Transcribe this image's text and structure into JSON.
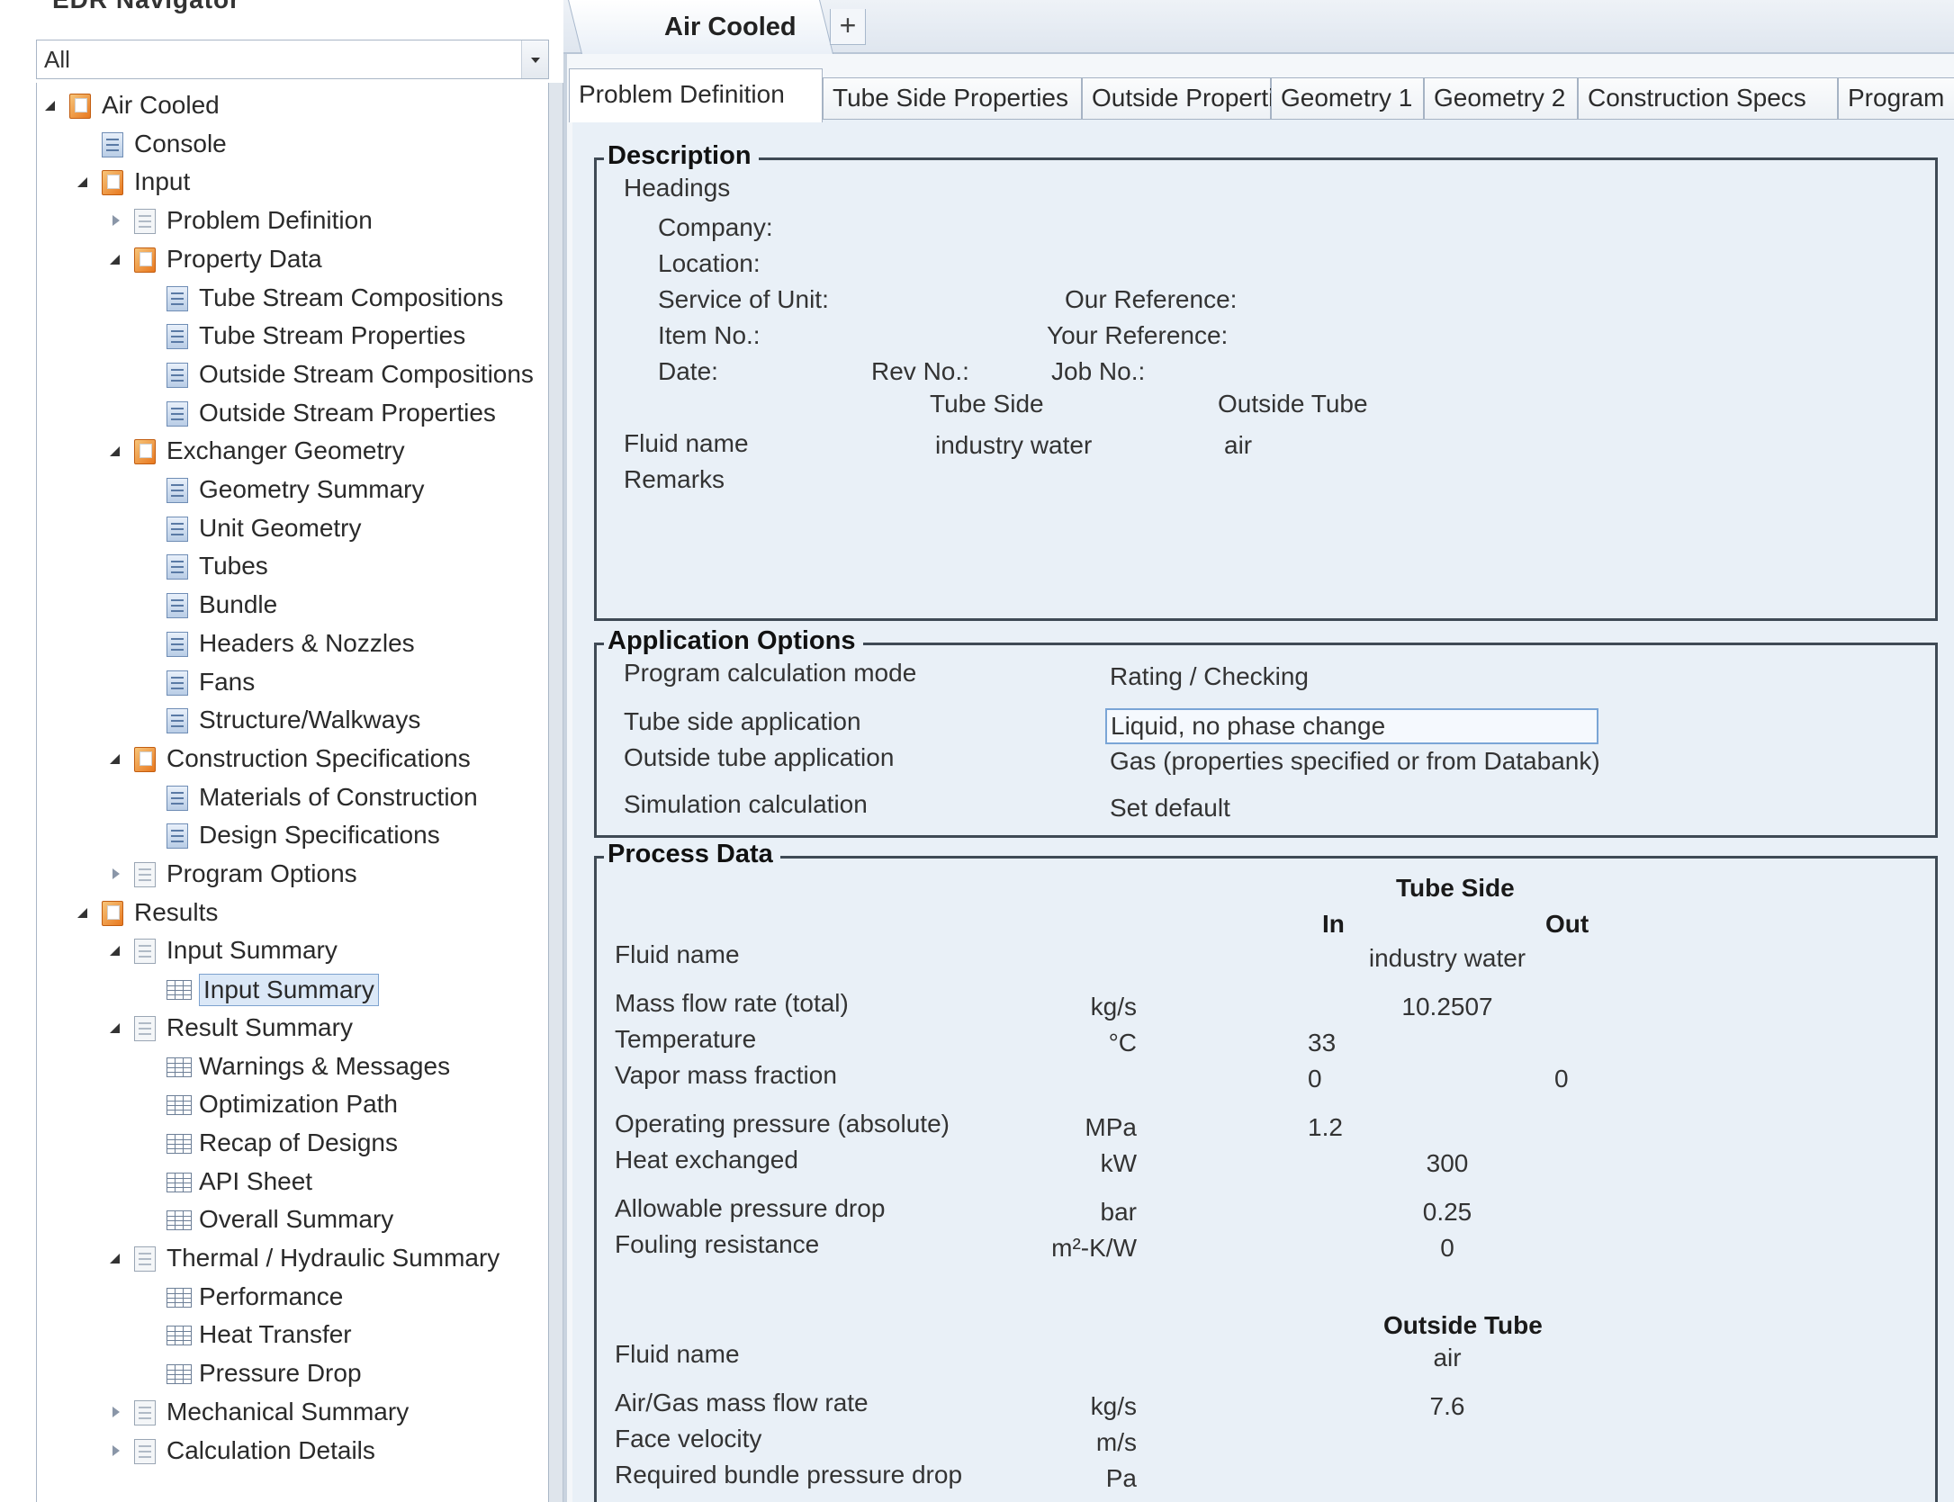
{
  "navigator": {
    "title": "EDR Navigator",
    "filter_value": "All",
    "tree": [
      {
        "label": "Air Cooled",
        "level": 0,
        "toggle": "expanded",
        "icon": "folder-icon"
      },
      {
        "label": "Console",
        "level": 1,
        "toggle": "none",
        "icon": "form-icon"
      },
      {
        "label": "Input",
        "level": 1,
        "toggle": "expanded",
        "icon": "folder-icon"
      },
      {
        "label": "Problem Definition",
        "level": 2,
        "toggle": "collapsed",
        "icon": "doc-icon"
      },
      {
        "label": "Property Data",
        "level": 2,
        "toggle": "expanded",
        "icon": "folder-icon"
      },
      {
        "label": "Tube Stream Compositions",
        "level": 3,
        "toggle": "none",
        "icon": "form-icon"
      },
      {
        "label": "Tube Stream Properties",
        "level": 3,
        "toggle": "none",
        "icon": "form-icon"
      },
      {
        "label": "Outside Stream Compositions",
        "level": 3,
        "toggle": "none",
        "icon": "form-icon"
      },
      {
        "label": "Outside Stream Properties",
        "level": 3,
        "toggle": "none",
        "icon": "form-icon"
      },
      {
        "label": "Exchanger Geometry",
        "level": 2,
        "toggle": "expanded",
        "icon": "folder-icon"
      },
      {
        "label": "Geometry Summary",
        "level": 3,
        "toggle": "none",
        "icon": "form-icon"
      },
      {
        "label": "Unit Geometry",
        "level": 3,
        "toggle": "none",
        "icon": "form-icon"
      },
      {
        "label": "Tubes",
        "level": 3,
        "toggle": "none",
        "icon": "form-icon"
      },
      {
        "label": "Bundle",
        "level": 3,
        "toggle": "none",
        "icon": "form-icon"
      },
      {
        "label": "Headers & Nozzles",
        "level": 3,
        "toggle": "none",
        "icon": "form-icon"
      },
      {
        "label": "Fans",
        "level": 3,
        "toggle": "none",
        "icon": "form-icon"
      },
      {
        "label": "Structure/Walkways",
        "level": 3,
        "toggle": "none",
        "icon": "form-icon"
      },
      {
        "label": "Construction Specifications",
        "level": 2,
        "toggle": "expanded",
        "icon": "folder-icon"
      },
      {
        "label": "Materials of Construction",
        "level": 3,
        "toggle": "none",
        "icon": "form-icon"
      },
      {
        "label": "Design Specifications",
        "level": 3,
        "toggle": "none",
        "icon": "form-icon"
      },
      {
        "label": "Program Options",
        "level": 2,
        "toggle": "collapsed",
        "icon": "doc-icon"
      },
      {
        "label": "Results",
        "level": 1,
        "toggle": "expanded",
        "icon": "folder-icon"
      },
      {
        "label": "Input Summary",
        "level": 2,
        "toggle": "expanded",
        "icon": "doc-icon"
      },
      {
        "label": "Input Summary",
        "level": 3,
        "toggle": "none",
        "icon": "table-icon",
        "selected": true
      },
      {
        "label": "Result Summary",
        "level": 2,
        "toggle": "expanded",
        "icon": "doc-icon"
      },
      {
        "label": "Warnings & Messages",
        "level": 3,
        "toggle": "none",
        "icon": "table-icon"
      },
      {
        "label": "Optimization Path",
        "level": 3,
        "toggle": "none",
        "icon": "table-icon"
      },
      {
        "label": "Recap of Designs",
        "level": 3,
        "toggle": "none",
        "icon": "table-icon"
      },
      {
        "label": "API Sheet",
        "level": 3,
        "toggle": "none",
        "icon": "table-icon"
      },
      {
        "label": "Overall Summary",
        "level": 3,
        "toggle": "none",
        "icon": "table-icon"
      },
      {
        "label": "Thermal / Hydraulic Summary",
        "level": 2,
        "toggle": "expanded",
        "icon": "doc-icon"
      },
      {
        "label": "Performance",
        "level": 3,
        "toggle": "none",
        "icon": "table-icon"
      },
      {
        "label": "Heat Transfer",
        "level": 3,
        "toggle": "none",
        "icon": "table-icon"
      },
      {
        "label": "Pressure Drop",
        "level": 3,
        "toggle": "none",
        "icon": "table-icon"
      },
      {
        "label": "Mechanical Summary",
        "level": 2,
        "toggle": "collapsed",
        "icon": "doc-icon"
      },
      {
        "label": "Calculation Details",
        "level": 2,
        "toggle": "collapsed",
        "icon": "doc-icon"
      }
    ]
  },
  "doc_tabs": {
    "active_label": "Air Cooled",
    "add_label": "+"
  },
  "subtabs": [
    {
      "label": "Problem Definition",
      "active": true
    },
    {
      "label": "Tube Side Properties"
    },
    {
      "label": "Outside Properties"
    },
    {
      "label": "Geometry 1"
    },
    {
      "label": "Geometry 2"
    },
    {
      "label": "Construction Specs"
    },
    {
      "label": "Program"
    }
  ],
  "description": {
    "legend": "Description",
    "headings_label": "Headings",
    "company_label": "Company:",
    "location_label": "Location:",
    "service_label": "Service of Unit:",
    "our_ref_label": "Our Reference:",
    "item_label": "Item No.:",
    "your_ref_label": "Your Reference:",
    "date_label": "Date:",
    "rev_label": "Rev No.:",
    "job_label": "Job No.:",
    "tube_side_header": "Tube Side",
    "outside_tube_header": "Outside Tube",
    "fluid_name_label": "Fluid name",
    "fluid_tube_value": "industry water",
    "fluid_outside_value": "air",
    "remarks_label": "Remarks"
  },
  "application": {
    "legend": "Application Options",
    "rows": [
      {
        "label": "Program calculation mode",
        "value": "Rating / Checking"
      },
      {
        "label": "Tube side application",
        "value": "Liquid, no phase change"
      },
      {
        "label": "Outside tube application",
        "value": "Gas (properties specified or from Databank)"
      },
      {
        "label": "Simulation calculation",
        "value": "Set default"
      }
    ]
  },
  "process": {
    "legend": "Process Data",
    "tube_side_header": "Tube Side",
    "in_header": "In",
    "out_header": "Out",
    "outside_tube_header": "Outside Tube",
    "tube_rows": [
      {
        "label": "Fluid name",
        "unit": "",
        "in": "",
        "span": "industry water",
        "out": ""
      },
      {
        "label": "Mass flow rate (total)",
        "unit": "kg/s",
        "in": "",
        "span": "10.2507",
        "out": ""
      },
      {
        "label": "Temperature",
        "unit": "°C",
        "in": "33",
        "span": "",
        "out": ""
      },
      {
        "label": "Vapor mass fraction",
        "unit": "",
        "in": "0",
        "span": "",
        "out": "0"
      },
      {
        "label": "Operating pressure (absolute)",
        "unit": "MPa",
        "in": "1.2",
        "span": "",
        "out": ""
      },
      {
        "label": "Heat exchanged",
        "unit": "kW",
        "in": "",
        "span": "300",
        "out": ""
      },
      {
        "label": "Allowable pressure drop",
        "unit": "bar",
        "in": "",
        "span": "0.25",
        "out": ""
      },
      {
        "label": "Fouling resistance",
        "unit": "m²-K/W",
        "in": "",
        "span": "0",
        "out": ""
      }
    ],
    "outside_rows": [
      {
        "label": "Fluid name",
        "unit": "",
        "span": "air"
      },
      {
        "label": "Air/Gas mass flow rate",
        "unit": "kg/s",
        "span": "7.6"
      },
      {
        "label": "Face velocity",
        "unit": "m/s",
        "span": ""
      },
      {
        "label": "Required bundle pressure drop",
        "unit": "Pa",
        "span": ""
      }
    ]
  }
}
